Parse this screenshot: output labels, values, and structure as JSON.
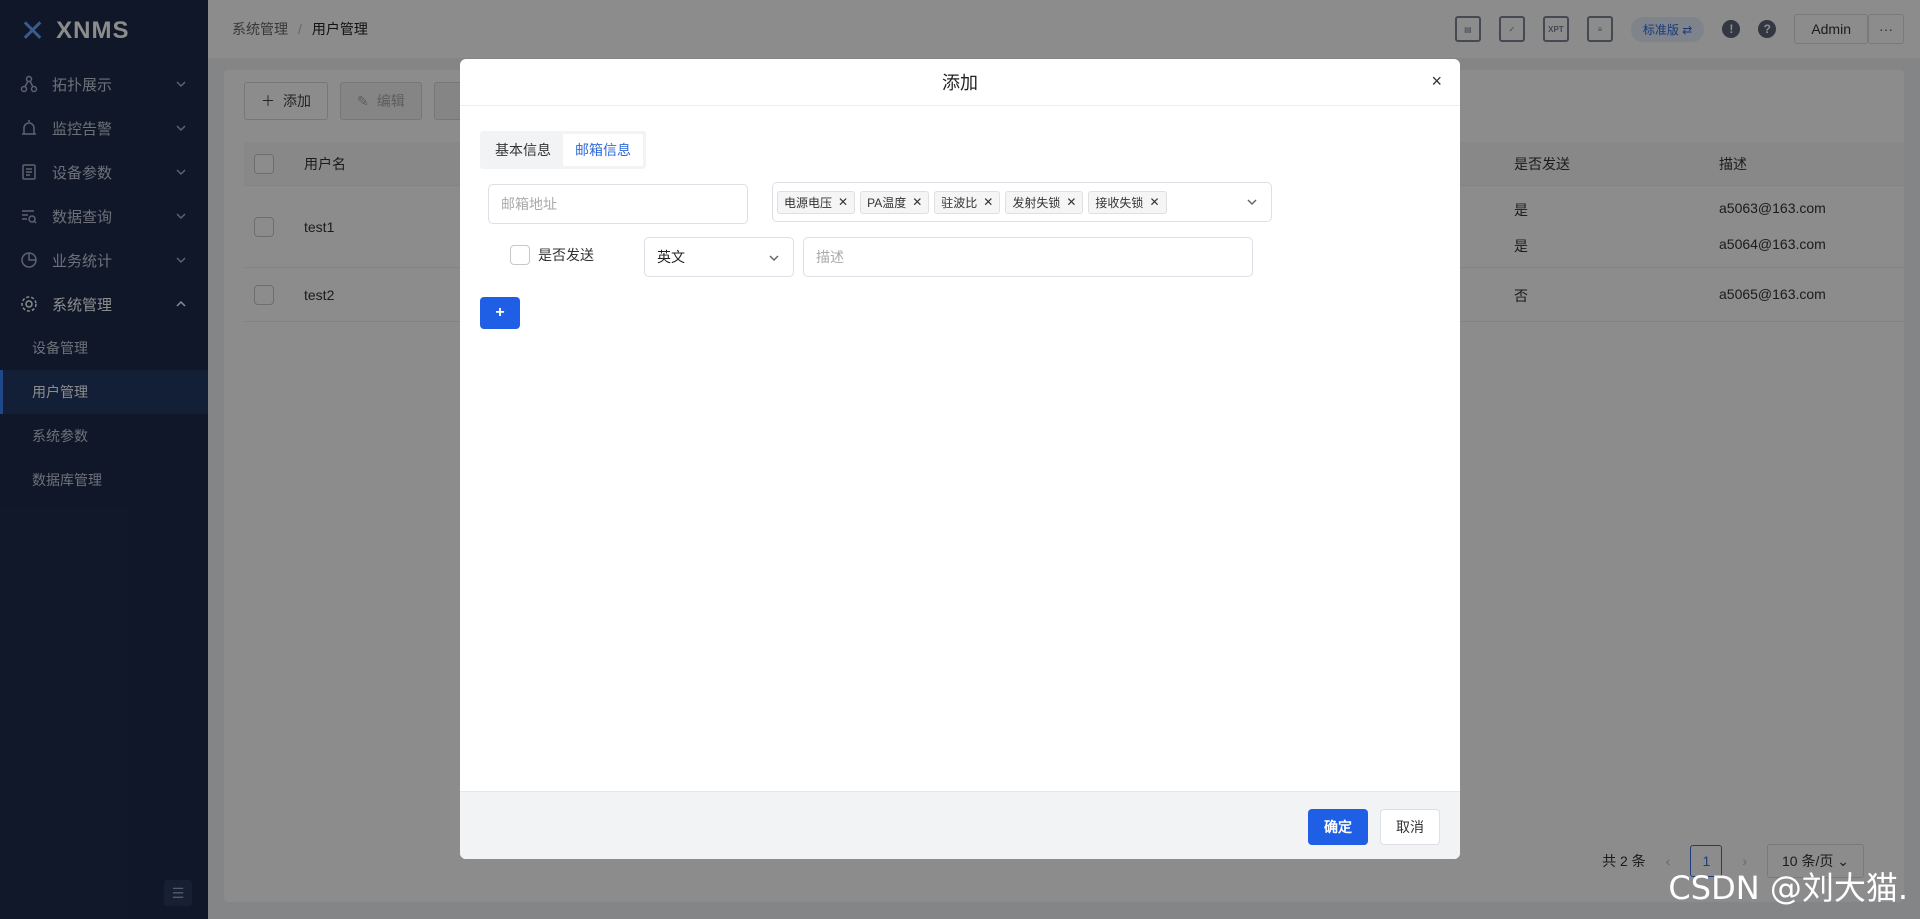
{
  "app": {
    "logo": "XNMS"
  },
  "sidebar": {
    "items": [
      {
        "label": "拓扑展示",
        "icon": "topology-icon"
      },
      {
        "label": "监控告警",
        "icon": "alarm-icon"
      },
      {
        "label": "设备参数",
        "icon": "device-params-icon"
      },
      {
        "label": "数据查询",
        "icon": "data-query-icon"
      },
      {
        "label": "业务统计",
        "icon": "pie-chart-icon"
      },
      {
        "label": "系统管理",
        "icon": "gear-icon"
      }
    ],
    "subitems": [
      "设备管理",
      "用户管理",
      "系统参数",
      "数据库管理"
    ],
    "active_sub": "用户管理"
  },
  "header": {
    "breadcrumb": [
      "系统管理",
      "用户管理"
    ],
    "xpt_label": "XPT",
    "edition": "标准版",
    "user": "Admin",
    "more": "···"
  },
  "toolbar": {
    "add": "添加",
    "edit": "编辑"
  },
  "table": {
    "headers": {
      "user": "用户名",
      "send": "是否发送",
      "desc": "描述"
    },
    "rows": [
      {
        "user": "test1",
        "lines": [
          {
            "send": "是",
            "desc": "a5063@163.com"
          },
          {
            "send": "是",
            "desc": "a5064@163.com"
          }
        ]
      },
      {
        "user": "test2",
        "lines": [
          {
            "send": "否",
            "desc": "a5065@163.com"
          }
        ]
      }
    ]
  },
  "pager": {
    "total": "共 2 条",
    "page": "1",
    "size": "10 条/页"
  },
  "dialog": {
    "title": "添加",
    "close": "×",
    "tabs": [
      "基本信息",
      "邮箱信息"
    ],
    "active_tab": "邮箱信息",
    "email_placeholder": "邮箱地址",
    "tags": [
      "电源电压",
      "PA温度",
      "驻波比",
      "发射失锁",
      "接收失锁"
    ],
    "send_checkbox_label": "是否发送",
    "language": "英文",
    "desc_placeholder": "描述",
    "add_row": "+",
    "ok": "确定",
    "cancel": "取消"
  },
  "watermark": "CSDN @刘大猫."
}
